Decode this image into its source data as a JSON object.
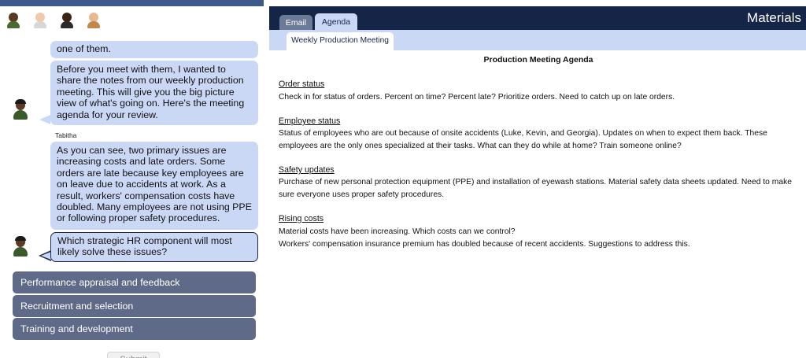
{
  "chat": {
    "partial_message": "one of them.",
    "message_1": "Before you meet with them, I wanted to share the notes from our weekly production meeting. This will give you the big picture view of what's going on. Here's the meeting agenda for your review.",
    "speaker_name": "Tabitha",
    "message_2": "As you can see, two primary issues are increasing costs and late orders. Some orders are late because key employees are on leave due to accidents at work. As a result, workers' compensation costs have doubled. Many employees are not using PPE or following proper safety procedures.",
    "question": "Which strategic HR component will most likely solve these issues?",
    "choices": [
      "Performance appraisal and feedback",
      "Recruitment and selection",
      "Training and development"
    ],
    "submit_label": "Submit"
  },
  "materials": {
    "title": "Materials",
    "tabs": [
      "Email",
      "Agenda"
    ],
    "active_tab": "Agenda",
    "subtab": "Weekly Production Meeting",
    "doc_title": "Production Meeting Agenda",
    "sections": [
      {
        "heading": "Order status",
        "lines": [
          "Check in for status of orders. Percent on time? Percent late? Prioritize orders. Need to catch up on late orders."
        ]
      },
      {
        "heading": "Employee status",
        "lines": [
          "Status of employees who are out because of onsite accidents (Luke, Kevin, and Georgia). Updates on when to expect them back. These employees are the only ones specialized at their tasks. What can they do while at home? Train someone online?"
        ]
      },
      {
        "heading": "Safety updates",
        "lines": [
          "Purchase of new personal protection equipment (PPE) and installation of eyewash stations. Material safety data sheets updated. Need to make sure everyone uses proper safety procedures."
        ]
      },
      {
        "heading": "Rising costs",
        "lines": [
          "Material costs have been increasing. Which costs can we control?",
          "Workers' compensation insurance premium has doubled because of recent accidents. Suggestions to address this."
        ]
      }
    ]
  },
  "colors": {
    "accent_dark": "#142548",
    "bubble": "#cbd8f5",
    "choice_button": "#5e6a87"
  },
  "icons": [
    "person-avatar-icon"
  ]
}
